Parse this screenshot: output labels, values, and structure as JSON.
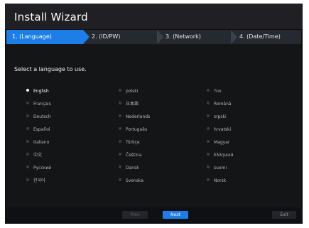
{
  "window": {
    "title": "Install Wizard"
  },
  "steps": [
    {
      "label": "1.  (Language)",
      "active": true
    },
    {
      "label": "2.  (ID/PW)",
      "active": false
    },
    {
      "label": "3.  (Network)",
      "active": false
    },
    {
      "label": "4.  (Date/Time)",
      "active": false
    }
  ],
  "prompt": "Select a language to use.",
  "languages": [
    [
      "English",
      "polski",
      "?no"
    ],
    [
      "Français",
      "日本語",
      "Română"
    ],
    [
      "Deutsch",
      "Nederlands",
      "srpski"
    ],
    [
      "Español",
      "Português",
      "hrvatski"
    ],
    [
      "Italiano",
      "Türkçe",
      "Magyar"
    ],
    [
      "中文",
      "Čeština",
      "Ελληνικά"
    ],
    [
      "Русский",
      "Dansk",
      "suomi"
    ],
    [
      "한국어",
      "Svenska",
      "Norsk"
    ]
  ],
  "selected_language": "English",
  "footer": {
    "prev_label": "Prev",
    "next_label": "Next",
    "exit_label": "Exit"
  },
  "colors": {
    "accent": "#1d7ee8",
    "background": "#141517"
  }
}
